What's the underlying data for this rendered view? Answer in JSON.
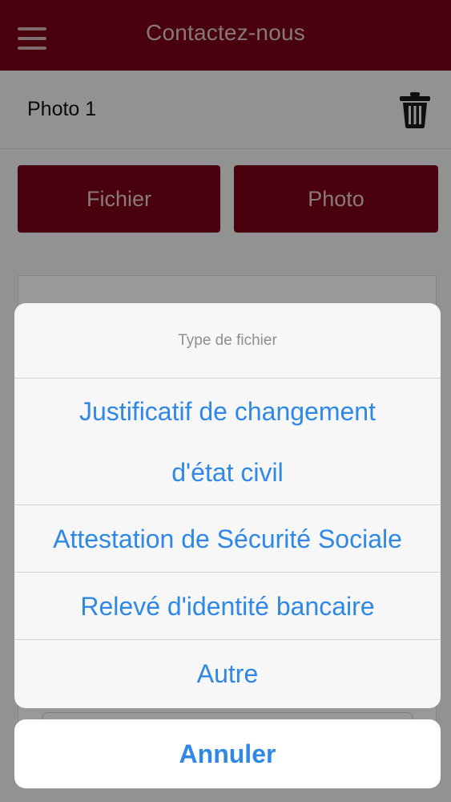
{
  "header": {
    "title": "Contactez-nous",
    "menu_icon": "hamburger-menu-icon",
    "background_color": "#7b0416"
  },
  "attachment": {
    "label": "Photo 1",
    "delete_icon": "trash-icon"
  },
  "buttons": {
    "file_label": "Fichier",
    "photo_label": "Photo"
  },
  "action_sheet": {
    "title": "Type de fichier",
    "options": [
      {
        "line1": "Justificatif de changement",
        "line2": "d'état civil"
      },
      {
        "label": "Attestation de Sécurité Sociale"
      },
      {
        "label": "Relevé d'identité bancaire"
      },
      {
        "label": "Autre"
      }
    ],
    "cancel_label": "Annuler",
    "option_color": "#2f87e6"
  }
}
